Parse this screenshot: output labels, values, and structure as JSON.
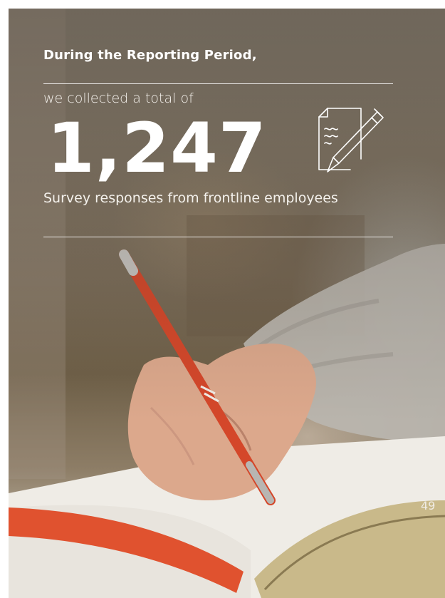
{
  "header": {
    "title": "During the Reporting Period,"
  },
  "stat": {
    "intro": "we collected a total of",
    "value": "1,247",
    "caption": "Survey responses from frontline employees"
  },
  "icons": {
    "survey": "survey-document-pen-icon"
  },
  "footer": {
    "page_number": "49"
  },
  "colors": {
    "text": "#ffffff",
    "pen": "#d4472a",
    "notebook_edge": "#e0522f"
  }
}
